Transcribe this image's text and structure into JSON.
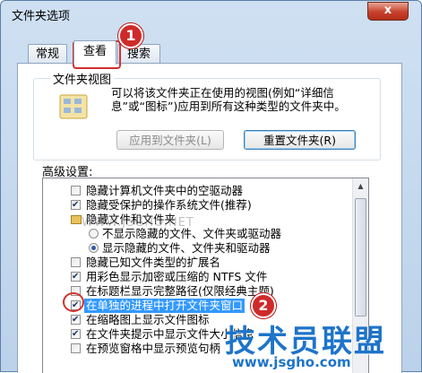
{
  "window": {
    "title": "文件夹选项",
    "close_label": "x"
  },
  "tabs": [
    {
      "label": "常规"
    },
    {
      "label": "查看",
      "active": true
    },
    {
      "label": "搜索"
    }
  ],
  "folder_view": {
    "group_label": "文件夹视图",
    "description": "可以将该文件夹正在使用的视图(例如“详细信息”或“图标”)应用到所有这种类型的文件夹中。",
    "apply_button": "应用到文件夹(L)",
    "reset_button": "重置文件夹(R)"
  },
  "advanced": {
    "label": "高级设置:",
    "items": [
      {
        "type": "checkbox",
        "checked": false,
        "label": "隐藏计算机文件夹中的空驱动器"
      },
      {
        "type": "checkbox",
        "checked": true,
        "label": "隐藏受保护的操作系统文件(推荐)"
      },
      {
        "type": "folder",
        "label": "隐藏文件和文件夹"
      },
      {
        "type": "radio",
        "checked": false,
        "label": "不显示隐藏的文件、文件夹或驱动器"
      },
      {
        "type": "radio",
        "checked": true,
        "label": "显示隐藏的文件、文件夹和驱动器"
      },
      {
        "type": "checkbox",
        "checked": false,
        "label": "隐藏已知文件类型的扩展名"
      },
      {
        "type": "checkbox",
        "checked": true,
        "label": "用彩色显示加密或压缩的 NTFS 文件"
      },
      {
        "type": "checkbox",
        "checked": false,
        "label": "在标题栏显示完整路径(仅限经典主题)"
      },
      {
        "type": "checkbox",
        "checked": true,
        "label": "在单独的进程中打开文件夹窗口",
        "highlight": true
      },
      {
        "type": "checkbox",
        "checked": true,
        "label": "在缩略图上显示文件图标"
      },
      {
        "type": "checkbox",
        "checked": true,
        "label": "在文件夹提示中显示文件大小信息"
      },
      {
        "type": "checkbox",
        "checked": false,
        "label": "在预览窗格中显示预览句柄"
      }
    ]
  },
  "annotations": {
    "marker1": "1",
    "marker2": "2"
  },
  "watermark": {
    "text": "WWW.JSGHO.NET",
    "brand": "技术员联盟",
    "url": "www.jsgho.com"
  },
  "colors": {
    "highlight": "#3399ff",
    "marker": "#cf2a2a",
    "brand": "#1e74c9"
  }
}
